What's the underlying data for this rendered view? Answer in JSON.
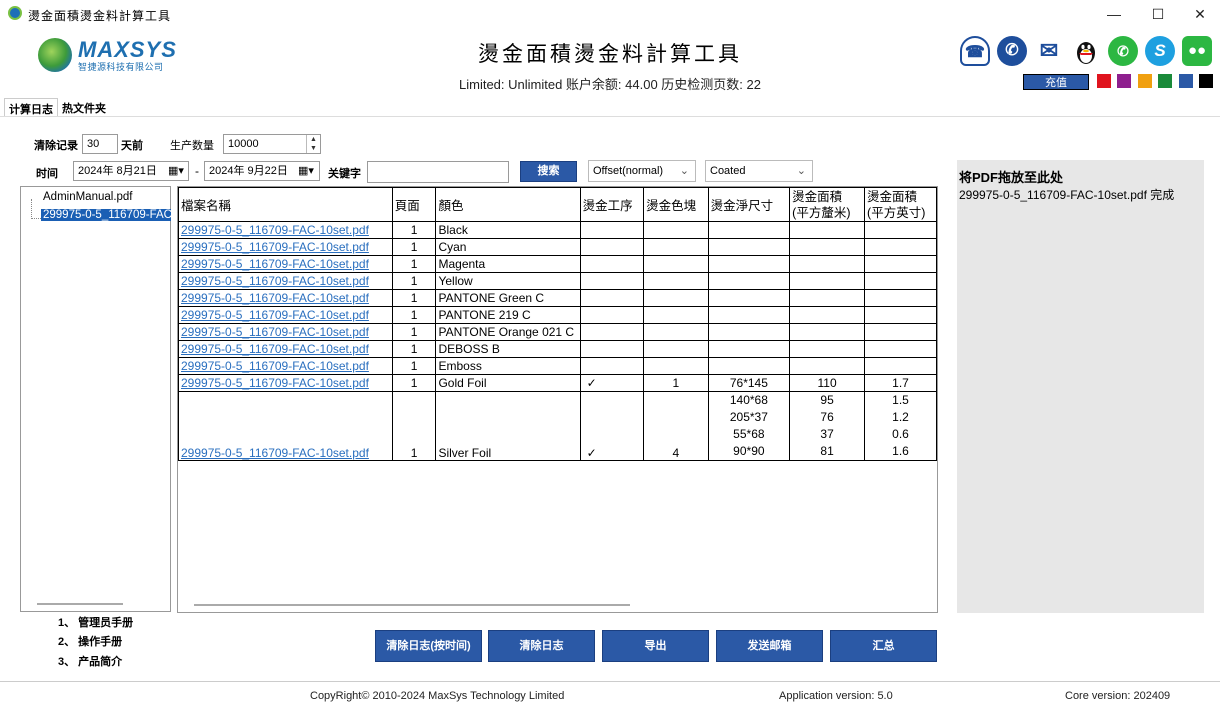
{
  "window": {
    "title": "燙金面積燙金料計算工具",
    "controls": {
      "minimize": "—",
      "maximize": "☐",
      "close": "✕"
    }
  },
  "header": {
    "logo_text": "MAXSYS",
    "logo_sub": "智捷源科技有限公司",
    "title": "燙金面積燙金料計算工具",
    "stats": "Limited:  Unlimited  账户余额:  44.00   历史检测页数:  22",
    "icons": [
      "support-icon",
      "phone-icon",
      "mail-icon",
      "qq-icon",
      "whatsapp-icon",
      "skype-icon",
      "wechat-icon"
    ],
    "recharge_label": "充值",
    "theme_colors": [
      "#e0141e",
      "#8e1f8e",
      "#f0a010",
      "#1a8a3a",
      "#2b59a6",
      "#000000"
    ]
  },
  "tabs": [
    {
      "label": "计算日志",
      "active": true
    },
    {
      "label": "热文件夹",
      "active": false
    }
  ],
  "filters": {
    "clear_label": "清除记录",
    "clear_days": "30",
    "days_label": "天前",
    "qty_label": "生产数量",
    "qty_value": "10000",
    "time_label": "时间",
    "date_from": "2024年  8月21日",
    "date_sep": "-",
    "date_to": "2024年  9月22日",
    "keyword_label": "关键字",
    "keyword_value": "",
    "search_label": "搜索",
    "print_mode": "Offset(normal)",
    "paper": "Coated"
  },
  "tree": {
    "items": [
      "AdminManual.pdf",
      "299975-0-5_116709-FAC"
    ]
  },
  "grid": {
    "headers": [
      "檔案名稱",
      "頁面",
      "顏色",
      "燙金工序",
      "燙金色塊",
      "燙金淨尺寸",
      "燙金面積\n(平方釐米)",
      "燙金面積\n(平方英寸)"
    ],
    "rows": [
      {
        "file": "299975-0-5_116709-FAC-10set.pdf",
        "page": "1",
        "color": "Black",
        "process": "",
        "blocks": "",
        "size": "",
        "cm2": "",
        "in2": ""
      },
      {
        "file": "299975-0-5_116709-FAC-10set.pdf",
        "page": "1",
        "color": "Cyan",
        "process": "",
        "blocks": "",
        "size": "",
        "cm2": "",
        "in2": ""
      },
      {
        "file": "299975-0-5_116709-FAC-10set.pdf",
        "page": "1",
        "color": "Magenta",
        "process": "",
        "blocks": "",
        "size": "",
        "cm2": "",
        "in2": ""
      },
      {
        "file": "299975-0-5_116709-FAC-10set.pdf",
        "page": "1",
        "color": "Yellow",
        "process": "",
        "blocks": "",
        "size": "",
        "cm2": "",
        "in2": ""
      },
      {
        "file": "299975-0-5_116709-FAC-10set.pdf",
        "page": "1",
        "color": "PANTONE Green C",
        "process": "",
        "blocks": "",
        "size": "",
        "cm2": "",
        "in2": ""
      },
      {
        "file": "299975-0-5_116709-FAC-10set.pdf",
        "page": "1",
        "color": "PANTONE 219 C",
        "process": "",
        "blocks": "",
        "size": "",
        "cm2": "",
        "in2": ""
      },
      {
        "file": "299975-0-5_116709-FAC-10set.pdf",
        "page": "1",
        "color": "PANTONE Orange 021 C",
        "process": "",
        "blocks": "",
        "size": "",
        "cm2": "",
        "in2": ""
      },
      {
        "file": "299975-0-5_116709-FAC-10set.pdf",
        "page": "1",
        "color": "DEBOSS B",
        "process": "",
        "blocks": "",
        "size": "",
        "cm2": "",
        "in2": ""
      },
      {
        "file": "299975-0-5_116709-FAC-10set.pdf",
        "page": "1",
        "color": "Emboss",
        "process": "",
        "blocks": "",
        "size": "",
        "cm2": "",
        "in2": ""
      },
      {
        "file": "299975-0-5_116709-FAC-10set.pdf",
        "page": "1",
        "color": "Gold Foil",
        "process": "✓",
        "blocks": "1",
        "size": "76*145",
        "cm2": "110",
        "in2": "1.7"
      },
      {
        "file": "299975-0-5_116709-FAC-10set.pdf",
        "page": "1",
        "color": "Silver Foil",
        "process": "✓",
        "blocks": "4",
        "size_lines": [
          "140*68",
          "205*37",
          "55*68",
          "90*90"
        ],
        "cm2_lines": [
          "95",
          "76",
          "37",
          "81"
        ],
        "in2_lines": [
          "1.5",
          "1.2",
          "0.6",
          "1.6"
        ]
      }
    ]
  },
  "drop_zone": {
    "title": "将PDF拖放至此处",
    "status": "299975-0-5_116709-FAC-10set.pdf  完成"
  },
  "manuals": [
    "1、 管理员手册",
    "2、 操作手册",
    "3、 产品简介"
  ],
  "actions": [
    "清除日志(按时间)",
    "清除日志",
    "导出",
    "发送邮箱",
    "汇总"
  ],
  "footer": {
    "copyright": "CopyRight©  2010-2024 MaxSys Technology Limited",
    "app_version": "Application version: 5.0",
    "core_version": "Core version: 202409"
  }
}
